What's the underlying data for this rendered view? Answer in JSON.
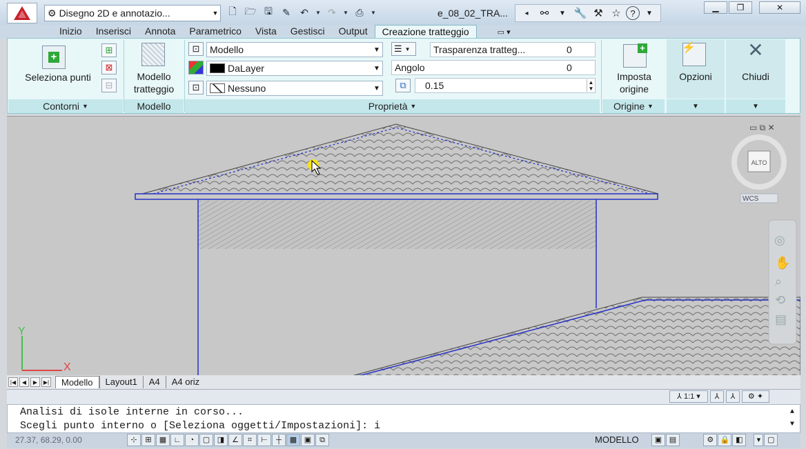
{
  "title_bar": {
    "workspace": "Disegno 2D e annotazio...",
    "document": "e_08_02_TRA...",
    "quick_access_icons": [
      "new-icon",
      "open-icon",
      "save-icon",
      "save-as-icon",
      "undo-icon",
      "redo-icon",
      "plot-icon"
    ],
    "window_controls": [
      "minimize-icon",
      "restore-icon",
      "close-icon"
    ]
  },
  "ribbon_tabs": [
    "Inizio",
    "Inserisci",
    "Annota",
    "Parametrico",
    "Vista",
    "Gestisci",
    "Output",
    "Creazione tratteggio"
  ],
  "active_tab": "Creazione tratteggio",
  "ribbon": {
    "contorni": {
      "select_points": "Seleziona punti",
      "panel_title": "Contorni"
    },
    "modello": {
      "button": [
        "Modello",
        "tratteggio"
      ],
      "panel_title": "Modello"
    },
    "proprieta": {
      "panel_title": "Proprietà",
      "hatch_type": "Modello",
      "color": "DaLayer",
      "background": "Nessuno",
      "transparency_label": "Trasparenza tratteg...",
      "transparency_value": "0",
      "angle_label": "Angolo",
      "angle_value": "0",
      "scale_value": "0.15"
    },
    "origine": {
      "button": [
        "Imposta",
        "origine"
      ],
      "panel_title": "Origine"
    },
    "opzioni": "Opzioni",
    "chiudi": "Chiudi"
  },
  "viewcube": {
    "face": "ALTO",
    "ucs": "WCS"
  },
  "ucs_labels": {
    "y": "Y",
    "x": "X"
  },
  "layout_tabs": [
    "Modello",
    "Layout1",
    "A4",
    "A4 oriz"
  ],
  "active_layout": "Modello",
  "annotation_scale": "1:1",
  "command_lines": [
    "Analisi di isole interne in corso...",
    "Scegli punto interno o [Seleziona oggetti/Impostazioni]: i"
  ],
  "status": {
    "coords": "27.37, 68.29, 0.00",
    "mode": "MODELLO"
  },
  "colors": {
    "accent": "#1f2dcc",
    "canvas": "#c8c8c8",
    "ribbon": "#e8f7f8"
  }
}
